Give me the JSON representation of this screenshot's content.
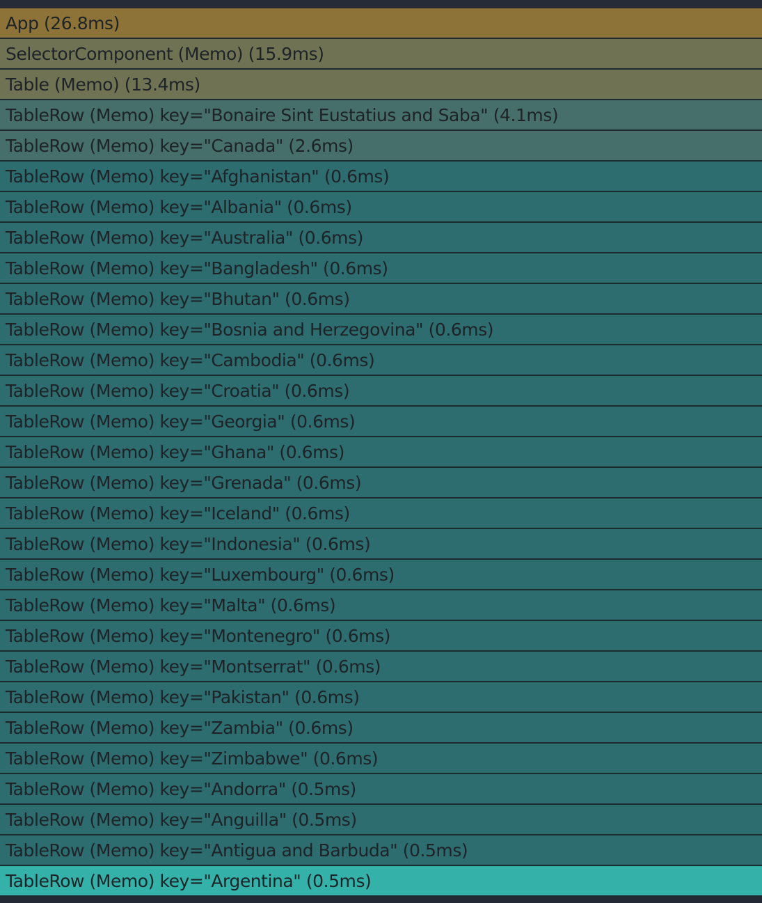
{
  "colors": {
    "app": "#8e7338",
    "memo_parent": "#707353",
    "medium": "#466f6b",
    "fast": "#2d6c6f",
    "selected": "#34b2a9",
    "row_border": "#1f2a30",
    "text": "#1d2327"
  },
  "ranked_chart": {
    "rows": [
      {
        "label": "App (26.8ms)",
        "color": "#8e7338"
      },
      {
        "label": "SelectorComponent (Memo) (15.9ms)",
        "color": "#707353"
      },
      {
        "label": "Table (Memo) (13.4ms)",
        "color": "#707353"
      },
      {
        "label": "TableRow (Memo) key=\"Bonaire Sint Eustatius and Saba\" (4.1ms)",
        "color": "#466f6b"
      },
      {
        "label": "TableRow (Memo) key=\"Canada\" (2.6ms)",
        "color": "#466f6b"
      },
      {
        "label": "TableRow (Memo) key=\"Afghanistan\" (0.6ms)",
        "color": "#2d6c6f"
      },
      {
        "label": "TableRow (Memo) key=\"Albania\" (0.6ms)",
        "color": "#2d6c6f"
      },
      {
        "label": "TableRow (Memo) key=\"Australia\" (0.6ms)",
        "color": "#2d6c6f"
      },
      {
        "label": "TableRow (Memo) key=\"Bangladesh\" (0.6ms)",
        "color": "#2d6c6f"
      },
      {
        "label": "TableRow (Memo) key=\"Bhutan\" (0.6ms)",
        "color": "#2d6c6f"
      },
      {
        "label": "TableRow (Memo) key=\"Bosnia and Herzegovina\" (0.6ms)",
        "color": "#2d6c6f"
      },
      {
        "label": "TableRow (Memo) key=\"Cambodia\" (0.6ms)",
        "color": "#2d6c6f"
      },
      {
        "label": "TableRow (Memo) key=\"Croatia\" (0.6ms)",
        "color": "#2d6c6f"
      },
      {
        "label": "TableRow (Memo) key=\"Georgia\" (0.6ms)",
        "color": "#2d6c6f"
      },
      {
        "label": "TableRow (Memo) key=\"Ghana\" (0.6ms)",
        "color": "#2d6c6f"
      },
      {
        "label": "TableRow (Memo) key=\"Grenada\" (0.6ms)",
        "color": "#2d6c6f"
      },
      {
        "label": "TableRow (Memo) key=\"Iceland\" (0.6ms)",
        "color": "#2d6c6f"
      },
      {
        "label": "TableRow (Memo) key=\"Indonesia\" (0.6ms)",
        "color": "#2d6c6f"
      },
      {
        "label": "TableRow (Memo) key=\"Luxembourg\" (0.6ms)",
        "color": "#2d6c6f"
      },
      {
        "label": "TableRow (Memo) key=\"Malta\" (0.6ms)",
        "color": "#2d6c6f"
      },
      {
        "label": "TableRow (Memo) key=\"Montenegro\" (0.6ms)",
        "color": "#2d6c6f"
      },
      {
        "label": "TableRow (Memo) key=\"Montserrat\" (0.6ms)",
        "color": "#2d6c6f"
      },
      {
        "label": "TableRow (Memo) key=\"Pakistan\" (0.6ms)",
        "color": "#2d6c6f"
      },
      {
        "label": "TableRow (Memo) key=\"Zambia\" (0.6ms)",
        "color": "#2d6c6f"
      },
      {
        "label": "TableRow (Memo) key=\"Zimbabwe\" (0.6ms)",
        "color": "#2d6c6f"
      },
      {
        "label": "TableRow (Memo) key=\"Andorra\" (0.5ms)",
        "color": "#2d6c6f"
      },
      {
        "label": "TableRow (Memo) key=\"Anguilla\" (0.5ms)",
        "color": "#2d6c6f"
      },
      {
        "label": "TableRow (Memo) key=\"Antigua and Barbuda\" (0.5ms)",
        "color": "#2d6c6f"
      },
      {
        "label": "TableRow (Memo) key=\"Argentina\" (0.5ms)",
        "color": "#34b2a9"
      }
    ]
  }
}
